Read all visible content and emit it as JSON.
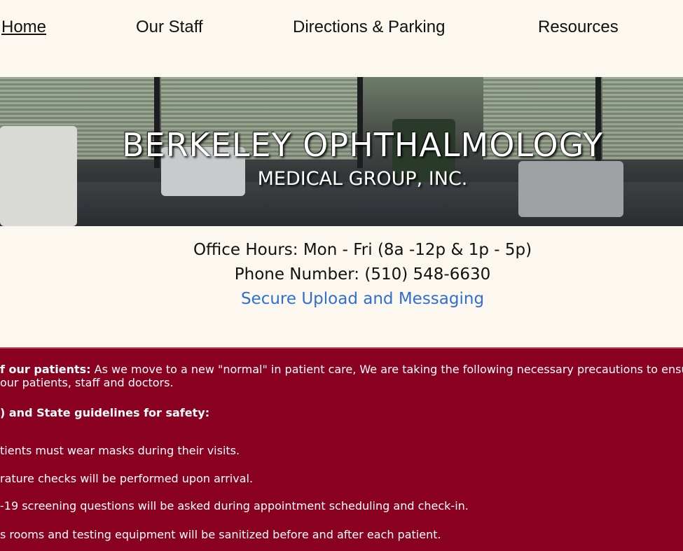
{
  "nav": {
    "items": [
      {
        "label": "Home",
        "active": true
      },
      {
        "label": "Our Staff"
      },
      {
        "label": "Directions & Parking"
      },
      {
        "label": "Resources"
      }
    ]
  },
  "hero": {
    "title": "BERKELEY OPHTHALMOLOGY",
    "subtitle": "MEDICAL GROUP, INC."
  },
  "info": {
    "hours": "Office Hours: Mon - Fri (8a -12p & 1p - 5p)",
    "phone": "Phone Number: (510) 548-6630",
    "secure_link": "Secure Upload and Messaging"
  },
  "notice": {
    "intro_bold": "f our patients:",
    "intro_text": " As we move to a new \"normal\" in patient care, We are taking the following necessary precautions to ensure t",
    "intro_line2": "our patients, staff and doctors.",
    "guidelines": ") and State guidelines for safety:",
    "items": [
      "tients must wear masks during their visits.",
      "rature checks will be performed upon arrival.",
      "-19 screening questions will be asked during appointment scheduling and check-in.",
      "s rooms and testing equipment will be sanitized before and after each patient."
    ]
  },
  "colors": {
    "page_bg": "#fdf8ef",
    "notice_bg": "#8a0020",
    "link": "#2f6fd0"
  }
}
